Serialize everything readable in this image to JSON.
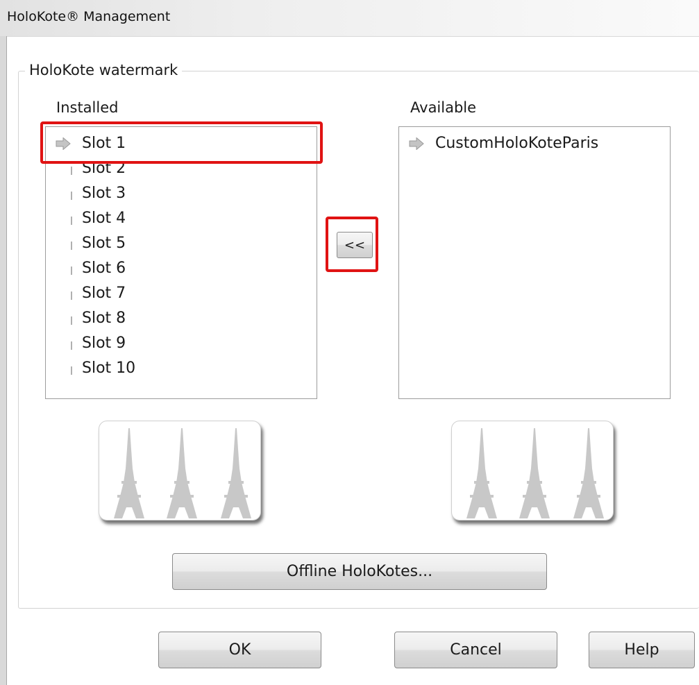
{
  "window": {
    "title": "HoloKote® Management"
  },
  "group": {
    "label": "HoloKote watermark"
  },
  "installed": {
    "label": "Installed",
    "items": [
      "Slot 1",
      "Slot 2",
      "Slot 3",
      "Slot 4",
      "Slot 5",
      "Slot 6",
      "Slot 7",
      "Slot 8",
      "Slot 9",
      "Slot 10"
    ],
    "selected": "Slot 1"
  },
  "available": {
    "label": "Available",
    "items": [
      "CustomHoloKoteParis"
    ]
  },
  "transfer_button": {
    "label": "<<"
  },
  "offline_button": {
    "label": "Offline HoloKotes..."
  },
  "footer": {
    "ok_label": "OK",
    "cancel_label": "Cancel",
    "help_label": "Help"
  },
  "icons": {
    "row_arrow": "arrow-right-icon",
    "empty_slot": "empty-slot-marker-icon",
    "preview": "eiffel-tower-icon"
  },
  "colors": {
    "highlight": "#e01313",
    "arrow": "#c4c4c4",
    "tower": "#c8c8c8"
  }
}
